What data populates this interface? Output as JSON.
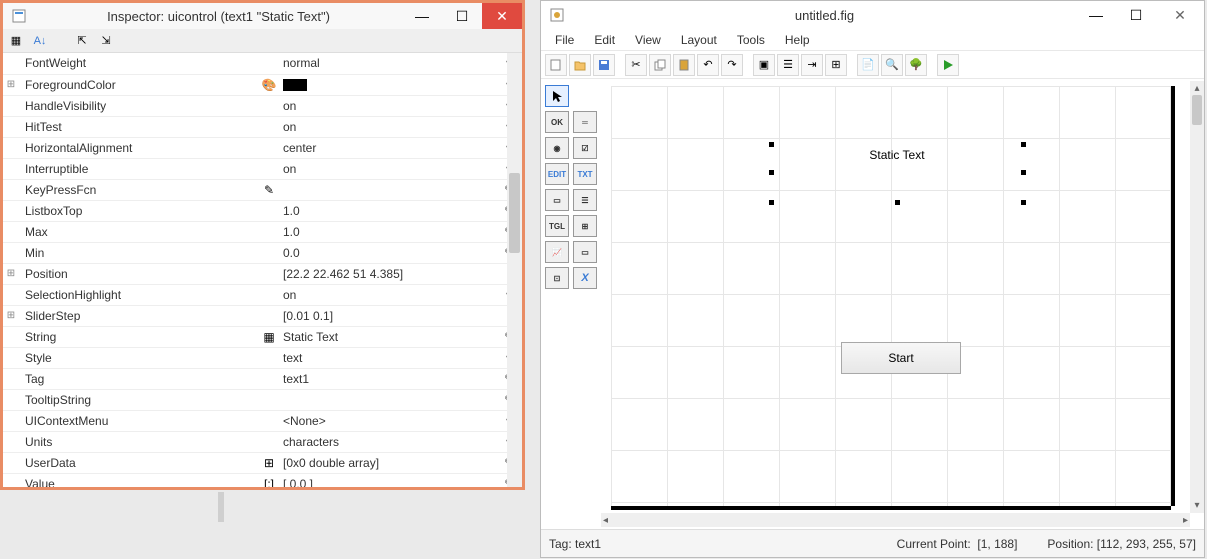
{
  "inspector": {
    "title": "Inspector:  uicontrol (text1 \"Static Text\")",
    "properties": [
      {
        "expand": "",
        "name": "FontWeight",
        "ico": "",
        "value": "normal",
        "act": "▾"
      },
      {
        "expand": "⊞",
        "name": "ForegroundColor",
        "ico": "🎨",
        "value": "",
        "swatch": true,
        "act": "▾"
      },
      {
        "expand": "",
        "name": "HandleVisibility",
        "ico": "",
        "value": "on",
        "act": "▾"
      },
      {
        "expand": "",
        "name": "HitTest",
        "ico": "",
        "value": "on",
        "act": "▾"
      },
      {
        "expand": "",
        "name": "HorizontalAlignment",
        "ico": "",
        "value": "center",
        "act": "▾"
      },
      {
        "expand": "",
        "name": "Interruptible",
        "ico": "",
        "value": "on",
        "act": "▾"
      },
      {
        "expand": "",
        "name": "KeyPressFcn",
        "ico": "✎",
        "value": "",
        "act": "✎"
      },
      {
        "expand": "",
        "name": "ListboxTop",
        "ico": "",
        "value": "1.0",
        "act": "✎"
      },
      {
        "expand": "",
        "name": "Max",
        "ico": "",
        "value": "1.0",
        "act": "✎"
      },
      {
        "expand": "",
        "name": "Min",
        "ico": "",
        "value": "0.0",
        "act": "✎"
      },
      {
        "expand": "⊞",
        "name": "Position",
        "ico": "",
        "value": "[22.2 22.462 51 4.385]",
        "act": ""
      },
      {
        "expand": "",
        "name": "SelectionHighlight",
        "ico": "",
        "value": "on",
        "act": "▾"
      },
      {
        "expand": "⊞",
        "name": "SliderStep",
        "ico": "",
        "value": "[0.01 0.1]",
        "act": ""
      },
      {
        "expand": "",
        "name": "String",
        "ico": "▦",
        "value": "Static Text",
        "act": "✎"
      },
      {
        "expand": "",
        "name": "Style",
        "ico": "",
        "value": "text",
        "act": "▾"
      },
      {
        "expand": "",
        "name": "Tag",
        "ico": "",
        "value": "text1",
        "act": "✎"
      },
      {
        "expand": "",
        "name": "TooltipString",
        "ico": "",
        "value": "",
        "act": "✎"
      },
      {
        "expand": "",
        "name": "UIContextMenu",
        "ico": "",
        "value": "<None>",
        "act": "▾"
      },
      {
        "expand": "",
        "name": "Units",
        "ico": "",
        "value": "characters",
        "act": "▾"
      },
      {
        "expand": "",
        "name": "UserData",
        "ico": "⊞",
        "value": "[0x0  double array]",
        "act": "✎"
      },
      {
        "expand": "",
        "name": "Value",
        "ico": "[:]",
        "value": "[ 0.0 ]",
        "act": "✎"
      }
    ]
  },
  "figure": {
    "title": "untitled.fig",
    "menu": [
      "File",
      "Edit",
      "View",
      "Layout",
      "Tools",
      "Help"
    ],
    "static_text": "Static Text",
    "start_button": "Start",
    "status": {
      "tag_label": "Tag:",
      "tag_value": "text1",
      "cp_label": "Current Point:",
      "cp_value": "[1, 188]",
      "pos_label": "Position:",
      "pos_value": "[112, 293, 255, 57]"
    }
  }
}
